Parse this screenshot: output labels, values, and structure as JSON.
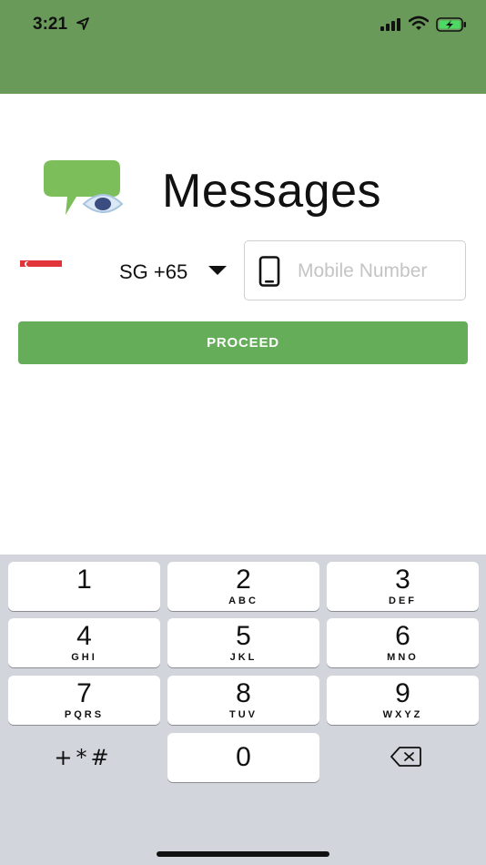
{
  "status_bar": {
    "time": "3:21",
    "color": "#6a9a5a"
  },
  "header": {
    "title": "Messages"
  },
  "phone_form": {
    "country_code": "SG +65",
    "mobile_placeholder": "Mobile Number",
    "mobile_value": ""
  },
  "proceed": {
    "label": "PROCEED",
    "color": "#66ad5a"
  },
  "keypad": {
    "keys": [
      {
        "num": "1",
        "letters": ""
      },
      {
        "num": "2",
        "letters": "ABC"
      },
      {
        "num": "3",
        "letters": "DEF"
      },
      {
        "num": "4",
        "letters": "GHI"
      },
      {
        "num": "5",
        "letters": "JKL"
      },
      {
        "num": "6",
        "letters": "MNO"
      },
      {
        "num": "7",
        "letters": "PQRS"
      },
      {
        "num": "8",
        "letters": "TUV"
      },
      {
        "num": "9",
        "letters": "WXYZ"
      },
      {
        "num": "0",
        "letters": ""
      }
    ],
    "symbols": "+*#"
  }
}
